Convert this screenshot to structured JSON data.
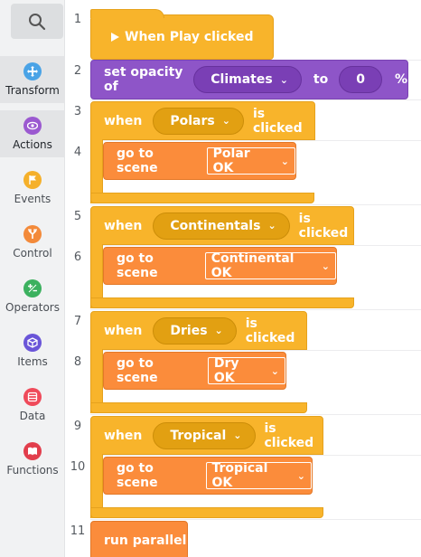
{
  "sidebar": {
    "search_icon": "search-icon",
    "categories": [
      {
        "label": "Transform",
        "color": "#4aa3e6",
        "icon": "move-icon",
        "active": true
      },
      {
        "label": "Actions",
        "color": "#9b59d0",
        "icon": "eye-icon",
        "active": true
      },
      {
        "label": "Events",
        "color": "#f5b02a",
        "icon": "flag-icon",
        "active": false
      },
      {
        "label": "Control",
        "color": "#f38a3a",
        "icon": "fork-icon",
        "active": false
      },
      {
        "label": "Operators",
        "color": "#3cb15f",
        "icon": "plus-minus-icon",
        "active": false
      },
      {
        "label": "Items",
        "color": "#6a55d8",
        "icon": "cube-icon",
        "active": false
      },
      {
        "label": "Data",
        "color": "#ef4a5a",
        "icon": "database-icon",
        "active": false
      },
      {
        "label": "Functions",
        "color": "#e23e4c",
        "icon": "book-icon",
        "active": false
      }
    ]
  },
  "editor": {
    "line_numbers": [
      "1",
      "2",
      "3",
      "4",
      "5",
      "6",
      "7",
      "8",
      "9",
      "10",
      "11"
    ],
    "play_block": {
      "label": "When Play clicked",
      "icon": "play-triangle-icon"
    },
    "opacity_block": {
      "prefix": "set opacity of",
      "target": "Climates",
      "to_word": "to",
      "value": "0",
      "suffix": "%"
    },
    "when_blocks": [
      {
        "when_word": "when",
        "target": "Polars",
        "suffix": "is clicked",
        "action": "go to scene",
        "scene": "Polar OK"
      },
      {
        "when_word": "when",
        "target": "Continentals",
        "suffix": "is clicked",
        "action": "go to scene",
        "scene": "Continental OK"
      },
      {
        "when_word": "when",
        "target": "Dries",
        "suffix": "is clicked",
        "action": "go to scene",
        "scene": "Dry OK"
      },
      {
        "when_word": "when",
        "target": "Tropical",
        "suffix": "is clicked",
        "action": "go to scene",
        "scene": "Tropical OK"
      }
    ],
    "parallel_block": {
      "label": "run parallel"
    }
  }
}
